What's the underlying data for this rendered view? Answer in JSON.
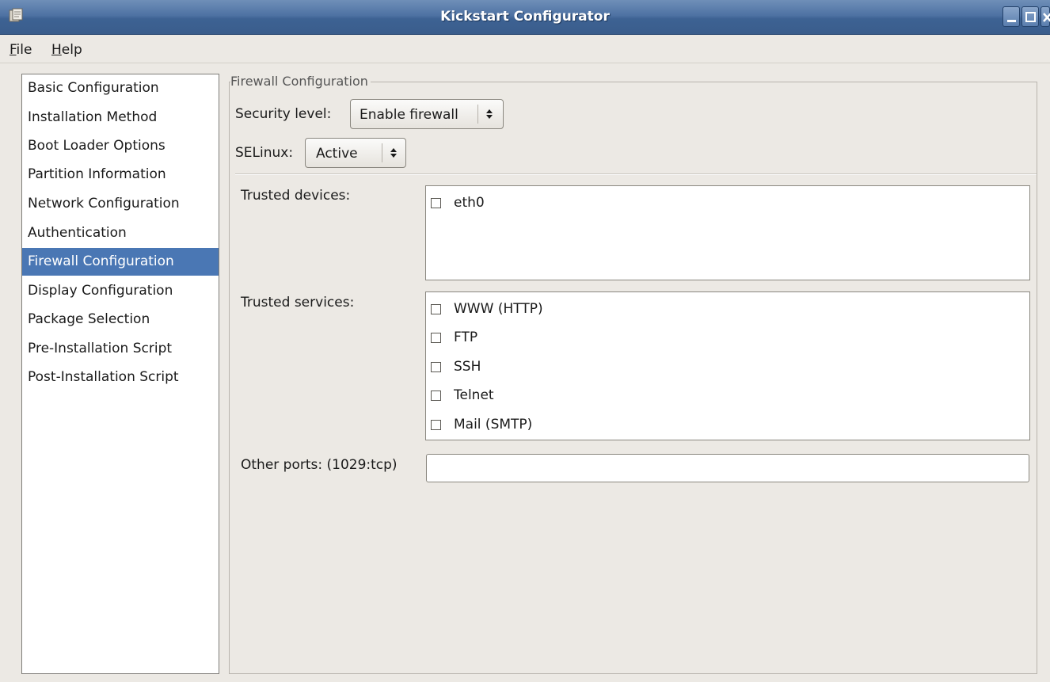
{
  "window": {
    "title": "Kickstart Configurator",
    "title_bar_color": "#4e72a3",
    "selection_color": "#4a77b4"
  },
  "menu": {
    "file": {
      "mnemonic": "F",
      "rest": "ile"
    },
    "help": {
      "mnemonic": "H",
      "rest": "elp"
    }
  },
  "nav": {
    "items": [
      {
        "label": "Basic Configuration",
        "selected": false
      },
      {
        "label": "Installation Method",
        "selected": false
      },
      {
        "label": "Boot Loader Options",
        "selected": false
      },
      {
        "label": "Partition Information",
        "selected": false
      },
      {
        "label": "Network Configuration",
        "selected": false
      },
      {
        "label": "Authentication",
        "selected": false
      },
      {
        "label": "Firewall Configuration",
        "selected": true
      },
      {
        "label": "Display Configuration",
        "selected": false
      },
      {
        "label": "Package Selection",
        "selected": false
      },
      {
        "label": "Pre-Installation Script",
        "selected": false
      },
      {
        "label": "Post-Installation Script",
        "selected": false
      }
    ]
  },
  "firewall": {
    "section_title": "Firewall Configuration",
    "security_level": {
      "label": "Security level:",
      "value": "Enable firewall"
    },
    "selinux": {
      "label": "SELinux:",
      "value": "Active"
    },
    "trusted_devices": {
      "label": "Trusted devices:",
      "items": [
        {
          "label": "eth0",
          "checked": false
        }
      ]
    },
    "trusted_services": {
      "label": "Trusted services:",
      "items": [
        {
          "label": "WWW (HTTP)",
          "checked": false
        },
        {
          "label": "FTP",
          "checked": false
        },
        {
          "label": "SSH",
          "checked": false
        },
        {
          "label": "Telnet",
          "checked": false
        },
        {
          "label": "Mail (SMTP)",
          "checked": false
        }
      ]
    },
    "other_ports": {
      "label": "Other ports: (1029:tcp)",
      "value": ""
    }
  }
}
